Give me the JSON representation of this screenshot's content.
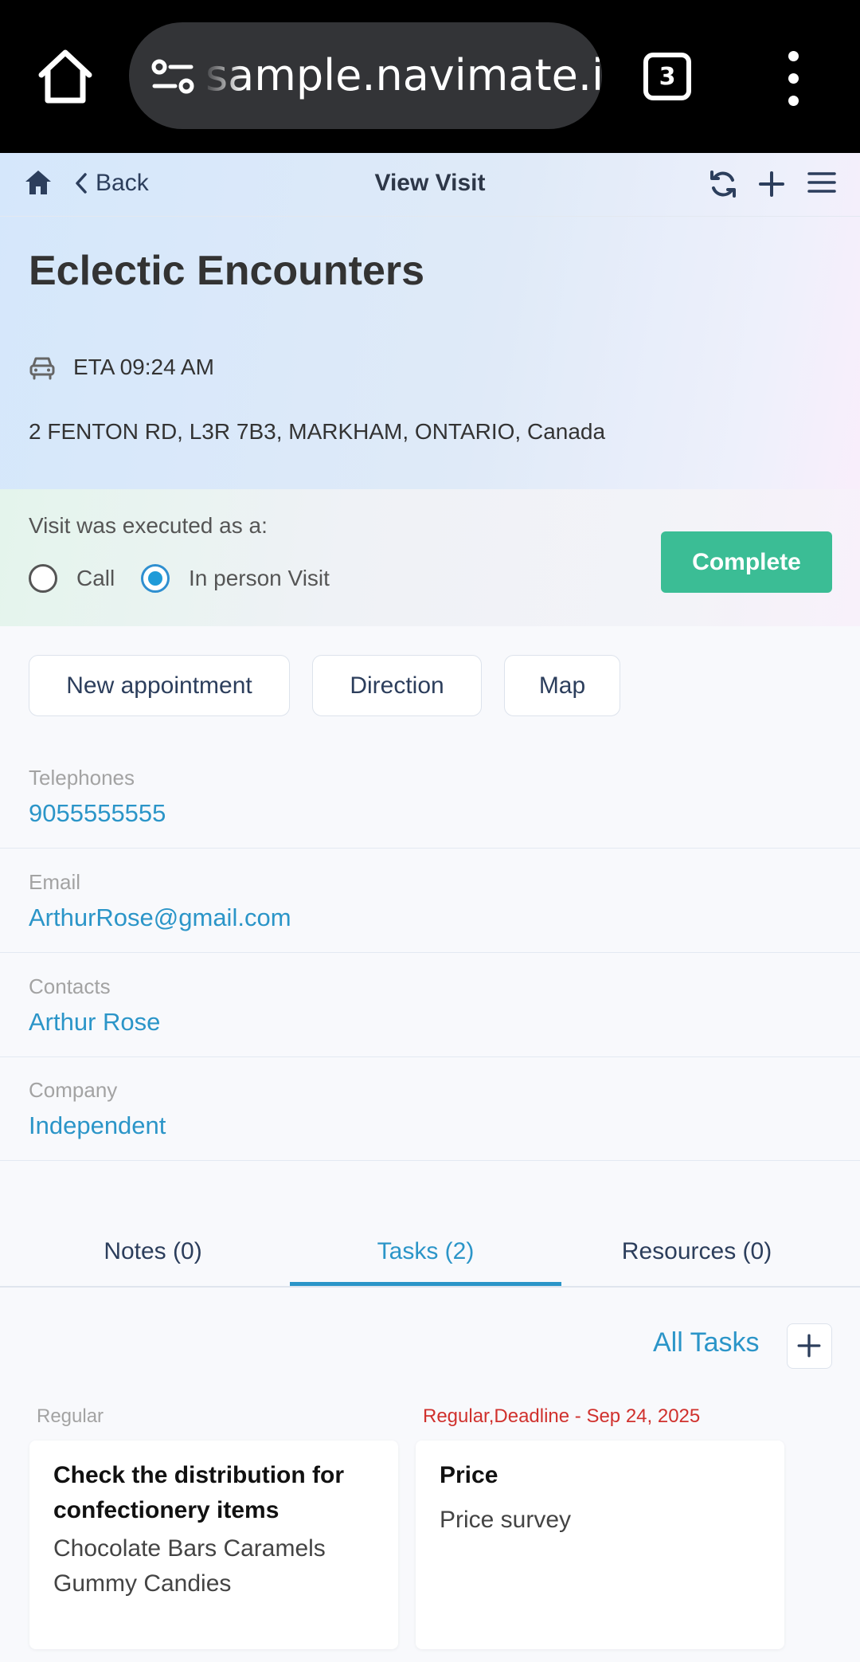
{
  "browser": {
    "url": "sample.navimate.io",
    "tab_count": "3"
  },
  "header": {
    "back_label": "Back",
    "title": "View Visit"
  },
  "visit": {
    "name": "Eclectic Encounters",
    "eta": "ETA 09:24 AM",
    "address": "2 FENTON RD, L3R 7B3, MARKHAM, ONTARIO, Canada"
  },
  "execution": {
    "label": "Visit was executed as a:",
    "options": [
      {
        "label": "Call",
        "selected": false
      },
      {
        "label": "In person Visit",
        "selected": true
      }
    ],
    "complete_label": "Complete"
  },
  "actions": {
    "new_appointment": "New appointment",
    "direction": "Direction",
    "map": "Map"
  },
  "fields": [
    {
      "label": "Telephones",
      "value": "9055555555"
    },
    {
      "label": "Email",
      "value": "ArthurRose@gmail.com"
    },
    {
      "label": "Contacts",
      "value": "Arthur Rose"
    },
    {
      "label": "Company",
      "value": "Independent"
    }
  ],
  "tabs": [
    {
      "label": "Notes (0)",
      "active": false
    },
    {
      "label": "Tasks (2)",
      "active": true
    },
    {
      "label": "Resources (0)",
      "active": false
    }
  ],
  "tasks_panel": {
    "all_tasks_label": "All Tasks",
    "tasks": [
      {
        "meta": "Regular",
        "title": "Check the distribution for confectionery items",
        "description": "Chocolate Bars Caramels Gummy Candies"
      },
      {
        "meta": "Regular,Deadline - Sep 24, 2025",
        "title": "Price",
        "description": "Price survey"
      }
    ]
  },
  "colors": {
    "accent": "#2b95c8",
    "complete": "#3bbd95",
    "deadline": "#d0312d",
    "navy": "#2c3e5c"
  }
}
